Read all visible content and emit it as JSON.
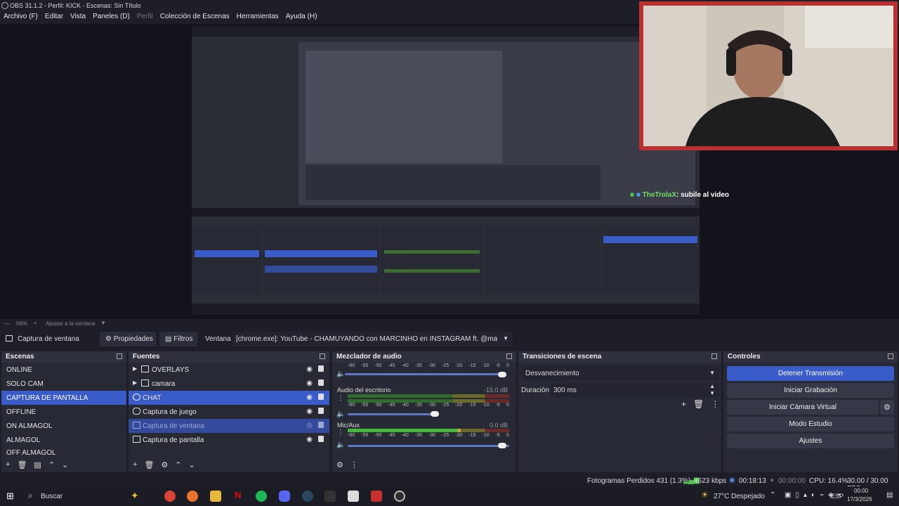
{
  "window": {
    "title": "OBS 31.1.2 - Perfil: KICK - Escenas: Sin Título"
  },
  "menu": [
    "Archivo (F)",
    "Editar",
    "Vista",
    "Paneles (D)",
    "Perfil",
    "Colección de Escenas",
    "Herramientas",
    "Ayuda (H)"
  ],
  "menu_disabled": [
    false,
    false,
    false,
    false,
    true,
    false,
    false,
    false
  ],
  "overlay_chat": {
    "user": "TheTrolaX",
    "message": ": subile al video"
  },
  "zoom": {
    "level": "56%",
    "plus": "+",
    "fit_label": "Ajustar a la ventana"
  },
  "source_bar": {
    "source_name": "Captura de ventana",
    "properties_label": "Propiedades",
    "filters_label": "Filtros",
    "window_label": "Ventana",
    "window_value": "[chrome.exe]: YouTube - CHAMUYANDO con MARCINHO en INSTAGRAM ft. @marcinhogz - You"
  },
  "scenes": {
    "title": "Escenas",
    "items": [
      "ONLINE",
      "SOLO CAM",
      "CAPTURA DE PANTALLA",
      "OFFLINE",
      "ON ALMAGOL",
      "ALMAGOL",
      "OFF ALMAGOL"
    ],
    "selected_index": 2
  },
  "sources": {
    "title": "Fuentes",
    "items": [
      {
        "label": "OVERLAYS",
        "type": "folder"
      },
      {
        "label": "camara",
        "type": "folder"
      },
      {
        "label": "CHAT",
        "type": "browser"
      },
      {
        "label": "Captura de juego",
        "type": "game"
      },
      {
        "label": "Captura de ventana",
        "type": "window"
      },
      {
        "label": "Captura de pantalla",
        "type": "display"
      }
    ]
  },
  "mixer": {
    "title": "Mezclador de audio",
    "scale": [
      "-60",
      "-55",
      "-50",
      "-45",
      "-40",
      "-35",
      "-30",
      "-25",
      "-20",
      "-15",
      "-10",
      "-5",
      "0"
    ],
    "channels": [
      {
        "name": "",
        "db": ""
      },
      {
        "name": "Audio del escritorio",
        "db": "-15.0 dB"
      },
      {
        "name": "Mic/Aux",
        "db": "0.0 dB"
      }
    ]
  },
  "transitions": {
    "title": "Transiciones de escena",
    "selected": "Desvanecimiento",
    "duration_label": "Duración",
    "duration_value": "300 ms"
  },
  "controls": {
    "title": "Controles",
    "buttons": [
      "Detener Transmisión",
      "Iniciar Grabación",
      "Iniciar Cámara Virtual",
      "Modo Estudio",
      "Ajustes"
    ]
  },
  "status": {
    "dropped": "Fotogramas Perdidos 431 (1.3%)",
    "bitrate": "4623 kbps",
    "stream_time": "00:18:13",
    "rec_time": "00:00:00",
    "cpu": "CPU: 16.4%",
    "fps": "30.00 / 30.00 FPS"
  },
  "taskbar": {
    "search": "Buscar",
    "weather": "27°C  Despejado",
    "lang": "ESP",
    "time": "00:00",
    "date": "17/3/2026"
  },
  "colors": {
    "accent": "#3a5cc8",
    "webcam_border": "#b8302f",
    "chat_user": "#6fe060"
  }
}
